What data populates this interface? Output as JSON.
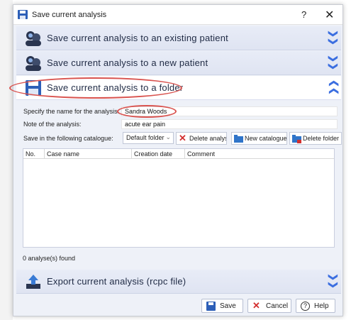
{
  "window": {
    "title": "Save current analysis",
    "help_label": "?",
    "close_label": "✕"
  },
  "sections": {
    "existing": {
      "title": "Save current analysis to an existing patient",
      "icon": "patient-group-icon",
      "chevron": "❯❯"
    },
    "new_patient": {
      "title": "Save current analysis to a new patient",
      "icon": "patient-add-icon",
      "chevron": "❯❯"
    },
    "folder": {
      "title": "Save current analysis to a folder",
      "icon": "floppy-disk-icon",
      "chevron": "❯❯"
    },
    "export": {
      "title": "Export current analysis (rcpc file)",
      "icon": "export-upload-icon",
      "chevron": "❯❯"
    }
  },
  "form": {
    "name_label": "Specify the name for the analysis:",
    "name_value": "Sandra Woods",
    "note_label": "Note of the analysis:",
    "note_value": "acute ear pain",
    "catalogue_label": "Save in the following catalogue:",
    "catalogue_value": "Default folder",
    "delete_analysis_label": "Delete analysi",
    "new_catalogue_label": "New catalogue",
    "delete_folder_label": "Delete folder"
  },
  "table": {
    "columns": [
      "No.",
      "Case name",
      "Creation date",
      "Comment"
    ],
    "rows": [],
    "status": "0 analyse(s) found"
  },
  "footer": {
    "save_label": "Save",
    "cancel_label": "Cancel",
    "help_label": "Help"
  },
  "colors": {
    "accent": "#3b6ee0",
    "highlight": "#d9534f",
    "panel": "#eef1f8"
  }
}
